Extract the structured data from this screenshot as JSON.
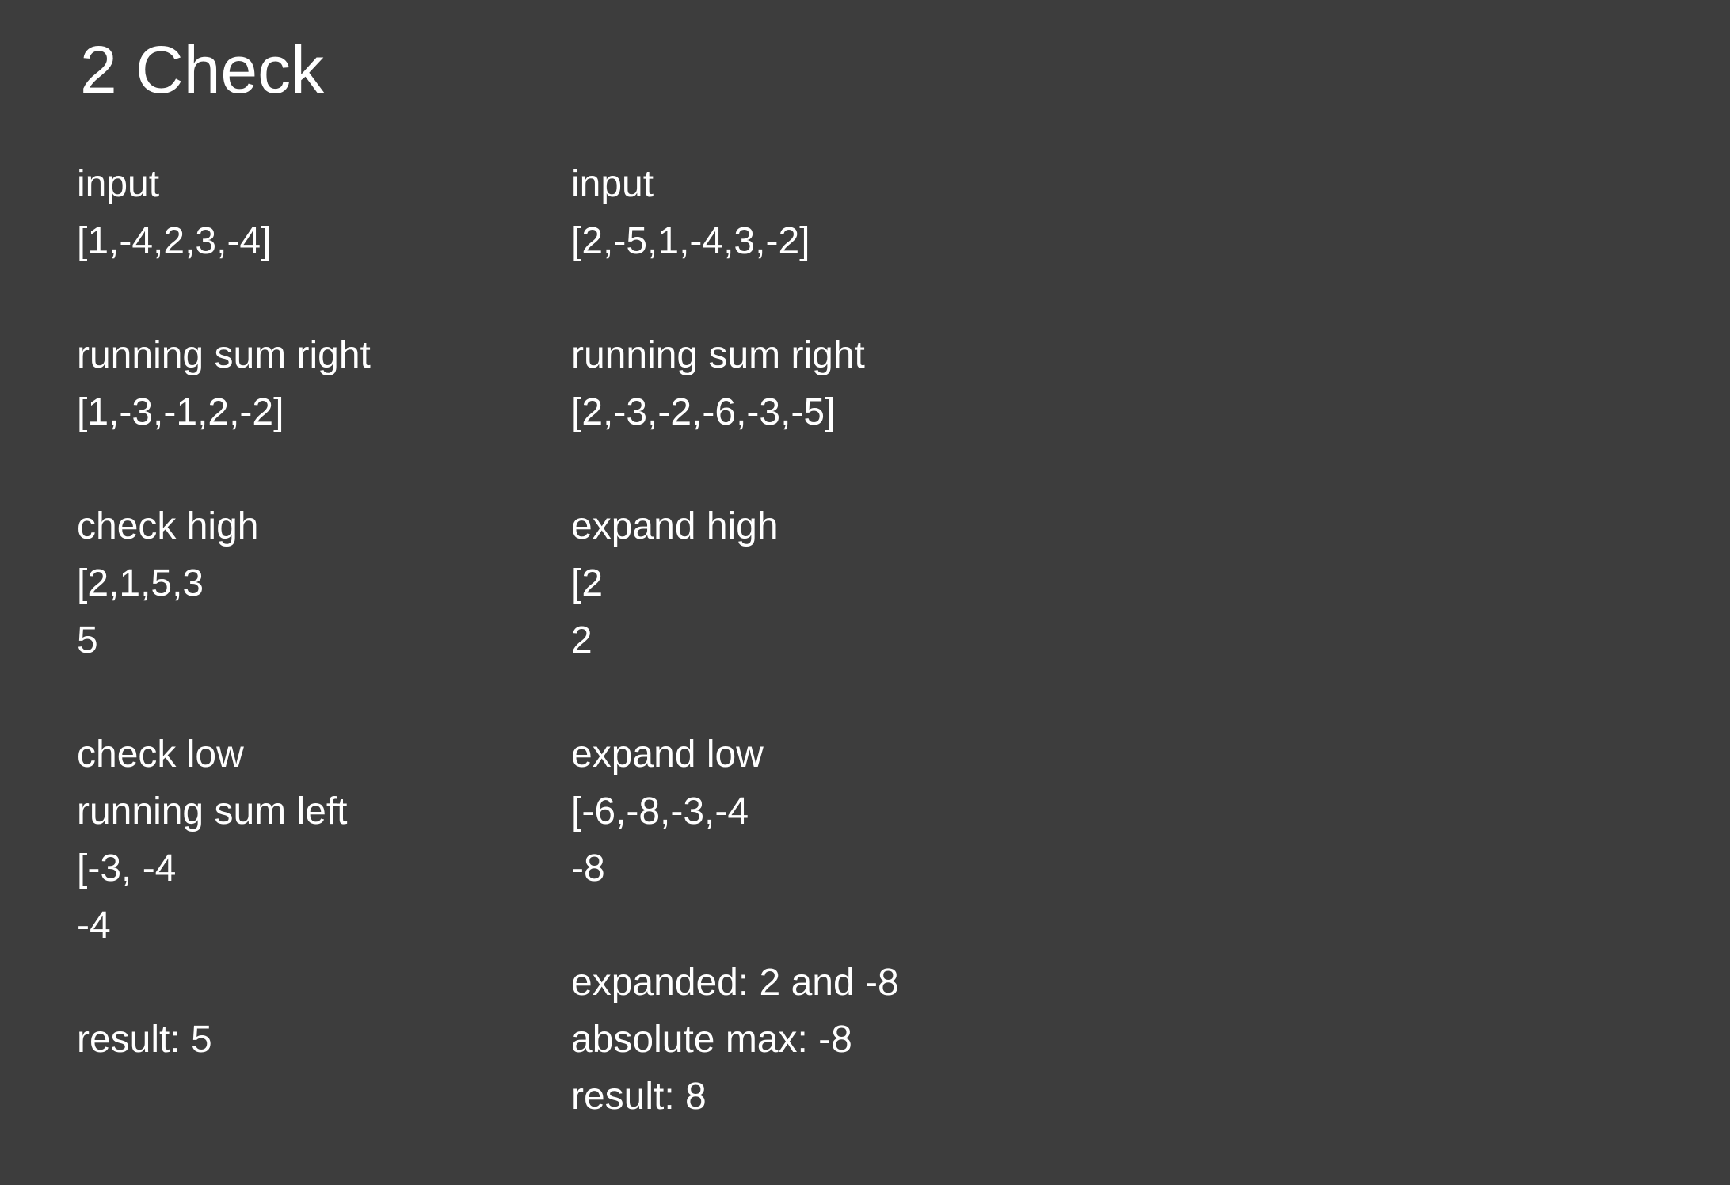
{
  "title": "2 Check",
  "left_column": [
    "input",
    "[1,-4,2,3,-4]",
    "",
    "running sum right",
    "[1,-3,-1,2,-2]",
    "",
    "check high",
    "[2,1,5,3",
    "5",
    "",
    "check low",
    "running sum left",
    "[-3, -4",
    "-4",
    "",
    "result: 5"
  ],
  "right_column": [
    "input",
    "[2,-5,1,-4,3,-2]",
    "",
    "running sum right",
    "[2,-3,-2,-6,-3,-5]",
    "",
    "expand high",
    "[2",
    "2",
    "",
    "expand low",
    "[-6,-8,-3,-4",
    "-8",
    "",
    "expanded: 2 and -8",
    "absolute max: -8",
    "result: 8"
  ]
}
